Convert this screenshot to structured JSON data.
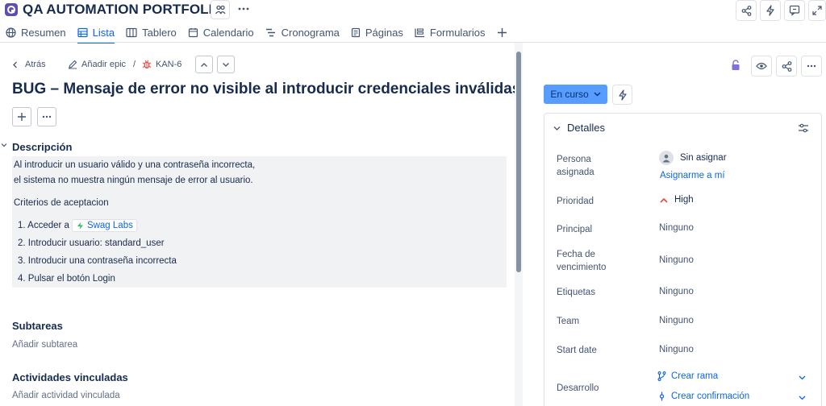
{
  "header": {
    "project_title": "QA AUTOMATION PORTFOLIO"
  },
  "tabs": [
    {
      "label": "Resumen",
      "icon": "globe-icon"
    },
    {
      "label": "Lista",
      "icon": "list-icon",
      "active": true
    },
    {
      "label": "Tablero",
      "icon": "board-icon"
    },
    {
      "label": "Calendario",
      "icon": "calendar-icon"
    },
    {
      "label": "Cronograma",
      "icon": "timeline-icon"
    },
    {
      "label": "Páginas",
      "icon": "pages-icon"
    },
    {
      "label": "Formularios",
      "icon": "forms-icon"
    }
  ],
  "breadcrumb": {
    "back": "Atrás",
    "add_epic": "Añadir epic",
    "separator": "/",
    "issue_key": "KAN-6"
  },
  "issue": {
    "title": "BUG – Mensaje de error no visible al introducir credenciales inválidas"
  },
  "description": {
    "heading": "Descripción",
    "line1": "Al introducir un usuario válido y una contraseña incorrecta,",
    "line2": "el sistema no muestra ningún mensaje de error al usuario.",
    "criteria_heading": "Criterios de aceptacion",
    "step1_prefix": "1. Acceder a",
    "step1_link": "Swag Labs",
    "step2": "2. Introducir usuario: standard_user",
    "step3": "3. Introducir una contraseña incorrecta",
    "step4": "4. Pulsar el botón Login"
  },
  "subtasks": {
    "heading": "Subtareas",
    "add": "Añadir subtarea"
  },
  "linked": {
    "heading": "Actividades vinculadas",
    "add": "Añadir actividad vinculada"
  },
  "status": {
    "label": "En curso"
  },
  "details": {
    "heading": "Detalles",
    "assignee_label": "Persona asignada",
    "assignee_value": "Sin asignar",
    "assign_me": "Asignarme a mí",
    "priority_label": "Prioridad",
    "priority_value": "High",
    "parent_label": "Principal",
    "parent_value": "Ninguno",
    "due_label": "Fecha de vencimiento",
    "due_value": "Ninguno",
    "labels_label": "Etiquetas",
    "labels_value": "Ninguno",
    "team_label": "Team",
    "team_value": "Ninguno",
    "start_label": "Start date",
    "start_value": "Ninguno",
    "dev_label": "Desarrollo",
    "dev_branch": "Crear rama",
    "dev_commit": "Crear confirmación"
  },
  "colors": {
    "accent": "#0c66e4",
    "status_bg": "#579dff",
    "priority_high": "#e2483d",
    "project_logo": "#5e4db2",
    "lock": "#8270db"
  }
}
